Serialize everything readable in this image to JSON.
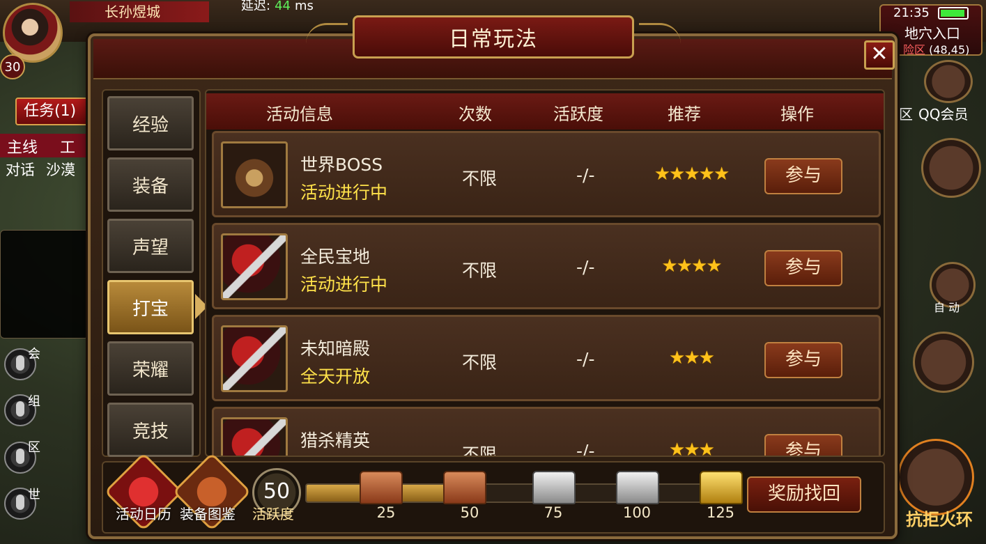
{
  "hud": {
    "player_name": "长孙煜城",
    "level": "30",
    "latency_label": "延迟:",
    "latency_value": "44",
    "latency_unit": "ms",
    "time": "21:35",
    "map_name": "地穴入口",
    "map_zone": "险区",
    "map_coords": "(48,45)",
    "task_tab": "任务(1)",
    "quest_tabs": [
      "主线",
      "工"
    ],
    "chat_channels": [
      "对话",
      "沙漠"
    ],
    "mic_labels": [
      "会",
      "组",
      "区",
      "世"
    ],
    "right_labels": {
      "qq": "QQ会员",
      "zone": "区",
      "auto": "自 动",
      "fire": "抗拒火环"
    }
  },
  "dialog": {
    "title": "日常玩法",
    "close_label": "✕",
    "side_tabs": [
      {
        "label": "经验",
        "active": false
      },
      {
        "label": "装备",
        "active": false
      },
      {
        "label": "声望",
        "active": false
      },
      {
        "label": "打宝",
        "active": true
      },
      {
        "label": "荣耀",
        "active": false
      },
      {
        "label": "竞技",
        "active": false
      }
    ],
    "table": {
      "headers": {
        "info": "活动信息",
        "count": "次数",
        "activity": "活跃度",
        "recommend": "推荐",
        "action": "操作"
      },
      "rows": [
        {
          "name": "世界BOSS",
          "status": "活动进行中",
          "count": "不限",
          "activity": "-/-",
          "stars": "★★★★★",
          "stars_count": 5,
          "button": "参与",
          "icon": "boss-box-icon"
        },
        {
          "name": "全民宝地",
          "status": "活动进行中",
          "count": "不限",
          "activity": "-/-",
          "stars": "★★★★",
          "stars_count": 4,
          "button": "参与",
          "icon": "treasure-sword-icon"
        },
        {
          "name": "未知暗殿",
          "status": "全天开放",
          "count": "不限",
          "activity": "-/-",
          "stars": "★★★",
          "stars_count": 3,
          "button": "参与",
          "icon": "treasure-sword-icon"
        },
        {
          "name": "猎杀精英",
          "status": "",
          "count": "不限",
          "activity": "-/-",
          "stars": "★★★",
          "stars_count": 3,
          "button": "参与",
          "icon": "treasure-sword-icon"
        }
      ]
    },
    "bottom": {
      "calendar_label": "活动日历",
      "gallery_label": "装备图鉴",
      "activity_value": "50",
      "activity_label": "活跃度",
      "progress_fraction": 0.34,
      "chests": [
        {
          "value": "25",
          "type": "bronze"
        },
        {
          "value": "50",
          "type": "bronze"
        },
        {
          "value": "75",
          "type": "silver"
        },
        {
          "value": "100",
          "type": "silver"
        },
        {
          "value": "125",
          "type": "gold"
        }
      ],
      "recover_label": "奖励找回"
    }
  },
  "colors": {
    "accent_gold": "#c9a050",
    "status_yellow": "#ffe24a",
    "star": "#ffc21a",
    "latency_green": "#5ef05a"
  }
}
